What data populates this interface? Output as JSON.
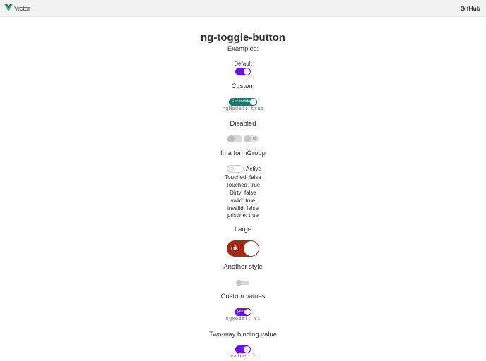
{
  "nav": {
    "brand": "Victor",
    "github": "GitHub"
  },
  "title": "ng-toggle-button",
  "examples_label": "Examples:",
  "colors": {
    "purple": "#6a11e8",
    "teal": "#0e7d6e",
    "brick": "#a52a16",
    "disabled": "#cfcfcf"
  },
  "sections": {
    "default": {
      "label": "Default",
      "checked": true
    },
    "custom": {
      "label": "Custom",
      "toggle_text": "Encendido",
      "model": "ngModel: true",
      "checked": true
    },
    "disabled": {
      "label": "Disabled",
      "toggle_text": "no"
    },
    "form_group": {
      "label": "In a formGroup",
      "toggle_label": "Active",
      "checked": false,
      "states": [
        "Touched: false",
        "Touched: true",
        "Dirty: false",
        "valid: true",
        "invalid: false",
        "pristine: true"
      ]
    },
    "large": {
      "label": "Large",
      "toggle_text": "ok",
      "checked": true
    },
    "another": {
      "label": "Another style",
      "checked": false
    },
    "custom_values": {
      "label": "Custom values",
      "toggle_text": "yes",
      "model": "ngModel: si",
      "checked": true
    },
    "two_way": {
      "label": "Two-way binding value",
      "model": "value: 1",
      "checked": true
    }
  }
}
